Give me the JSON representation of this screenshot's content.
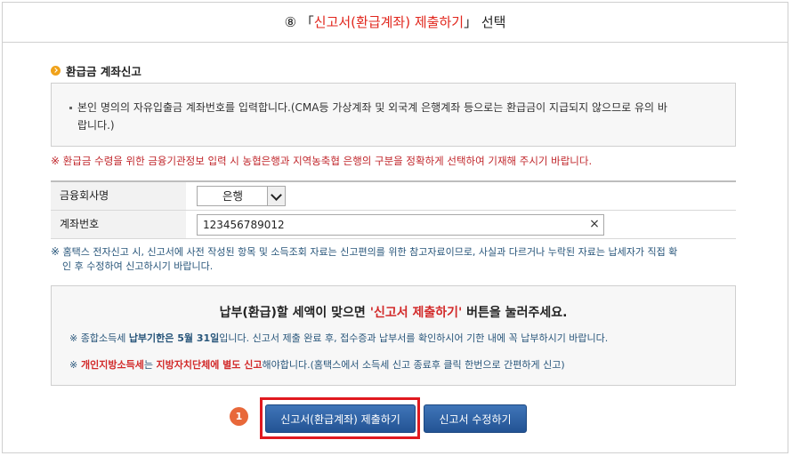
{
  "header": {
    "prefix": "⑧ 「",
    "highlight": "신고서(환급계좌) 제출하기",
    "suffix": "」 선택"
  },
  "refund_section": {
    "title": "환급금 계좌신고",
    "notice_lines": [
      "본인 명의의 자유입출금 계좌번호를 입력합니다.(CMA등 가상계좌 및 외국계 은행계좌 등으로는 환급금이 지급되지 않으므로 유의 바",
      "랍니다.)"
    ]
  },
  "warnings": {
    "mark": "※",
    "bank_distinction": "환급금 수령을 위한 금융기관정보 입력 시 농협은행과 지역농축협 은행의 구분을 정확하게 선택하여 기재해 주시기 바랍니다.",
    "reference_lines": [
      "홈택스 전자신고 시, 신고서에 사전 작성된 항목 및 소득조회 자료는 신고편의를 위한 참고자료이므로, 사실과 다르거나 누락된 자료는 납세자가 직접 확",
      "인 후 수정하여 신고하시기 바랍니다."
    ]
  },
  "form": {
    "bank_label": "금융회사명",
    "bank_selected": "은행",
    "account_label": "계좌번호",
    "account_value": "123456789012",
    "clear_glyph": "×"
  },
  "submit_box": {
    "headline_prefix": "납부(환급)할 세액이 맞으면 ",
    "headline_highlight": "'신고서 제출하기'",
    "headline_suffix": " 버튼을 눌러주세요.",
    "line1_mark": "※",
    "line1_text_a": " 종합소득세 ",
    "line1_bold": "납부기한은 5월 31일",
    "line1_text_b": "입니다. 신고서 제출 완료 후, 접수증과 납부서를 확인하시어 기한 내에 꼭 납부하시기 바랍니다.",
    "line2_mark": "※",
    "line2_red_a": " 개인지방소득세",
    "line2_text_a": "는 ",
    "line2_red_b": "지방자치단체에 별도 신고",
    "line2_text_b": "해야합니다.(홈택스에서 소득세 신고 종료후 클릭 한번으로 간편하게 신고)"
  },
  "step_badge": "1",
  "buttons": {
    "submit_label": "신고서(환급계좌) 제출하기",
    "edit_label": "신고서 수정하기"
  },
  "colors": {
    "accent_red": "#e1261c",
    "button_blue": "#2f63a6",
    "highlight_border": "#e0191f",
    "notice_blue": "#27557a"
  }
}
